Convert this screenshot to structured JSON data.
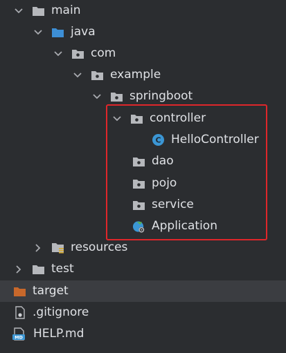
{
  "tree": {
    "nodes": [
      {
        "label": "main",
        "icon": "folder-icon",
        "expanded": true
      },
      {
        "label": "java",
        "icon": "source-folder-icon",
        "expanded": true
      },
      {
        "label": "com",
        "icon": "package-icon",
        "expanded": true
      },
      {
        "label": "example",
        "icon": "package-icon",
        "expanded": true
      },
      {
        "label": "springboot",
        "icon": "package-icon",
        "expanded": true
      },
      {
        "label": "controller",
        "icon": "package-icon",
        "expanded": true
      },
      {
        "label": "HelloController",
        "icon": "java-class-icon"
      },
      {
        "label": "dao",
        "icon": "package-icon"
      },
      {
        "label": "pojo",
        "icon": "package-icon"
      },
      {
        "label": "service",
        "icon": "package-icon"
      },
      {
        "label": "Application",
        "icon": "spring-boot-app-icon"
      },
      {
        "label": "resources",
        "icon": "resources-folder-icon",
        "expanded": false
      },
      {
        "label": "test",
        "icon": "folder-icon",
        "expanded": false
      },
      {
        "label": "target",
        "icon": "excluded-folder-icon",
        "selected": true
      },
      {
        "label": ".gitignore",
        "icon": "gitignore-file-icon"
      },
      {
        "label": "HELP.md",
        "icon": "markdown-file-icon"
      }
    ]
  },
  "colors": {
    "background": "#2b2d30",
    "selection": "#3b3d41",
    "highlight_border": "#e0262a",
    "folder": "#b6b8bc",
    "source_folder": "#3d8fd6",
    "excluded_folder": "#c8682b",
    "class_icon": "#3b96d4",
    "spring_green": "#5bb04b"
  }
}
